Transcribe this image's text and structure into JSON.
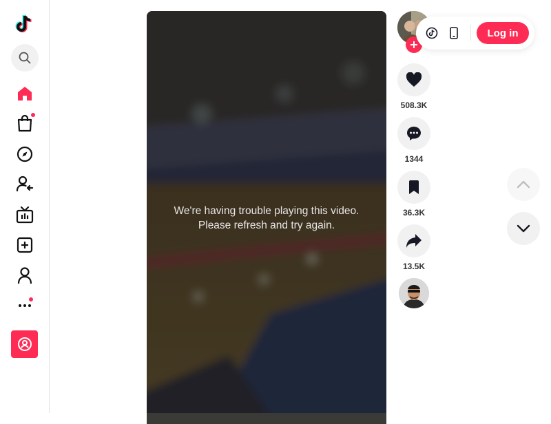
{
  "sidebar": {
    "logo": "tiktok-logo",
    "items": [
      {
        "name": "search",
        "icon": "search-icon"
      },
      {
        "name": "home",
        "icon": "home-icon",
        "active": true
      },
      {
        "name": "shop",
        "icon": "shopping-bag-icon",
        "badge": true
      },
      {
        "name": "explore",
        "icon": "compass-icon"
      },
      {
        "name": "following",
        "icon": "user-follow-icon"
      },
      {
        "name": "live",
        "icon": "live-tv-icon"
      },
      {
        "name": "upload",
        "icon": "plus-square-icon"
      },
      {
        "name": "profile",
        "icon": "person-icon"
      },
      {
        "name": "more",
        "icon": "more-dots-icon",
        "badge": true
      }
    ],
    "profile_button_icon": "user-circle-icon"
  },
  "video": {
    "error_message": "We're having trouble playing this video. Please refresh and try again."
  },
  "actions": {
    "likes": "508.3K",
    "comments": "1344",
    "saves": "36.3K",
    "shares": "13.5K"
  },
  "header": {
    "login_label": "Log in",
    "icons": [
      "tiktok-coin-icon",
      "mobile-device-icon"
    ]
  },
  "colors": {
    "accent": "#fe2c55",
    "surface": "#f1f1f2",
    "text": "#161823"
  }
}
